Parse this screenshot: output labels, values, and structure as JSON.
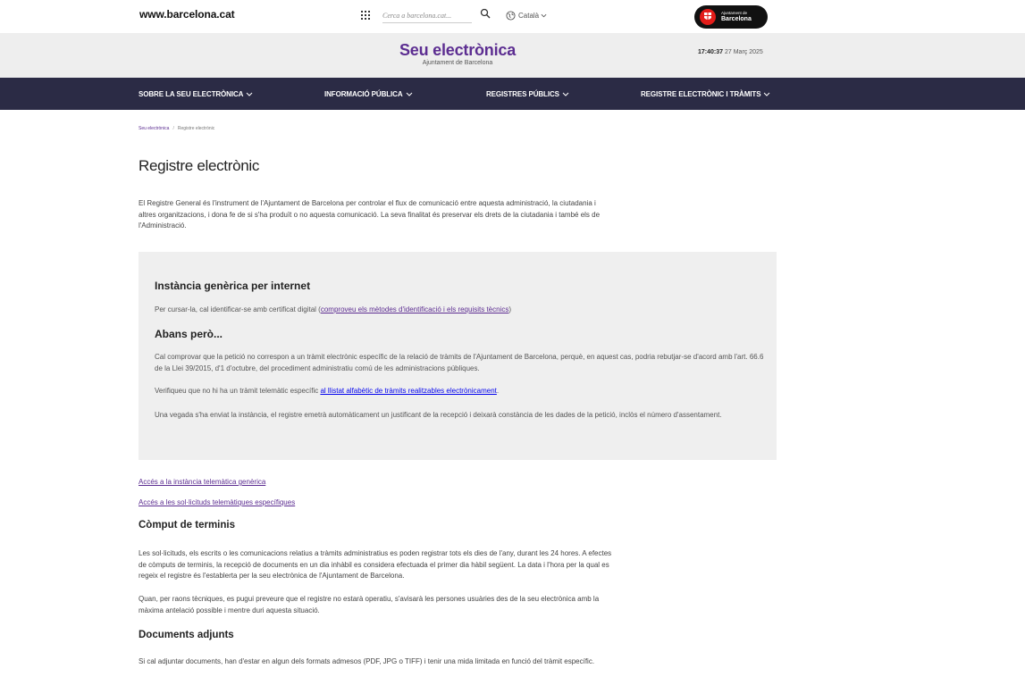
{
  "topbar": {
    "site_url": "www.barcelona.cat",
    "search_placeholder": "Cerca a barcelona.cat...",
    "language": "Català",
    "logo_line1": "Ajuntament de",
    "logo_line2": "Barcelona"
  },
  "header": {
    "title": "Seu electrònica",
    "subtitle": "Ajuntament de Barcelona",
    "time": "17:40:37",
    "date": "27 Març 2025"
  },
  "nav": {
    "items": [
      {
        "label": "SOBRE LA SEU ELECTRÒNICA"
      },
      {
        "label": "INFORMACIÓ PÚBLICA"
      },
      {
        "label": "REGISTRES PÚBLICS"
      },
      {
        "label": "REGISTRE ELECTRÒNIC I TRÀMITS"
      }
    ]
  },
  "breadcrumb": {
    "root": "Seu electrònica",
    "separator": "/",
    "current": "Registre electrònic"
  },
  "page": {
    "title": "Registre electrònic",
    "intro": "El Registre General és l'instrument de l'Ajuntament de Barcelona per controlar el flux de comunicació entre aquesta administració, la ciutadania i altres organitzacions, i dona fe de si s'ha produït o no aquesta comunicació. La seva finalitat és preservar els drets de la ciutadania i també els de l'Administració."
  },
  "box": {
    "heading1": "Instància genèrica per internet",
    "p1_prefix": "Per cursar-la, cal identificar-se amb certificat digital (",
    "p1_link": "comproveu els mètodes d'identificació i els requisits tècnics",
    "p1_suffix": ")",
    "heading2": "Abans però...",
    "p2": "Cal comprovar que la petició no correspon a un tràmit electrònic específic de la relació de tràmits de l'Ajuntament de Barcelona, perquè, en aquest cas, podria rebutjar-se d'acord amb l'art. 66.6 de la Llei 39/2015, d'1 d'octubre, del procediment administratiu comú de les administracions públiques.",
    "p3_prefix": "Verifiqueu que no hi ha un tràmit telemàtic específic ",
    "p3_link": "al llistat alfabètic de tràmits realitzables electrònicament",
    "p3_suffix": ".",
    "p4": "Una vegada s'ha enviat la instància, el registre emetrà automàticament un justificant de la recepció i deixarà constància de les dades de la petició, inclòs el número d'assentament."
  },
  "links": {
    "generic": "Accés a la instància telemàtica genèrica",
    "specific": "Accés a les sol·licituds telemàtiques específiques"
  },
  "terms": {
    "heading": "Còmput de terminis",
    "p1": "Les sol·licituds, els escrits o les comunicacions relatius a tràmits administratius es poden registrar tots els dies de l'any, durant les 24 hores. A efectes de còmputs de terminis, la recepció de documents en un dia inhàbil es considera efectuada el primer dia hàbil següent. La data i l'hora per la qual es regeix el registre és l'establerta per la seu electrònica de l'Ajuntament de Barcelona.",
    "p2": "Quan, per raons tècniques, es pugui preveure que el registre no estarà operatiu, s'avisarà les persones usuàries des de la seu electrònica amb la màxima antelació possible i mentre duri aquesta situació."
  },
  "attachments": {
    "heading": "Documents adjunts",
    "p1": "Si cal adjuntar documents, han d'estar en algun dels formats admesos (PDF, JPG o TIFF) i tenir una mida limitada en funció del tràmit específic."
  },
  "colors": {
    "brand_purple": "#5c2d91",
    "nav_bg": "#2b2b45",
    "header_bg": "#eeeeee",
    "box_bg": "#efefef",
    "logo_red": "#e31d1a"
  }
}
